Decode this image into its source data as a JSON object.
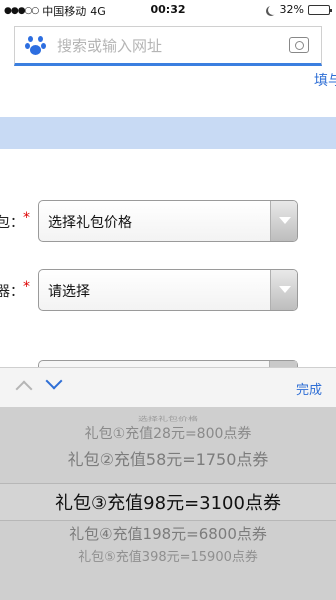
{
  "status_bar": {
    "carrier": "中国移动",
    "network": "4G",
    "time": "00:32",
    "battery": "32%",
    "battery_level": 0.32
  },
  "search": {
    "placeholder": "搜索或输入网址"
  },
  "header": {
    "action": "填与"
  },
  "form": {
    "row1": {
      "label": "包：",
      "required": "*",
      "value": "选择礼包价格"
    },
    "row2": {
      "label": "器：",
      "required": "*",
      "value": "请选择"
    }
  },
  "picker": {
    "done_label": "完成",
    "options": [
      "选择礼包价格",
      "礼包①充值28元=800点券",
      "礼包②充值58元=1750点券",
      "礼包③充值98元=3100点券",
      "礼包④充值198元=6800点券",
      "礼包⑤充值398元=15900点券"
    ],
    "selected_index": 3
  },
  "colors": {
    "accent": "#2f6fd6",
    "band": "#c8daf4",
    "required": "#dd0000"
  }
}
